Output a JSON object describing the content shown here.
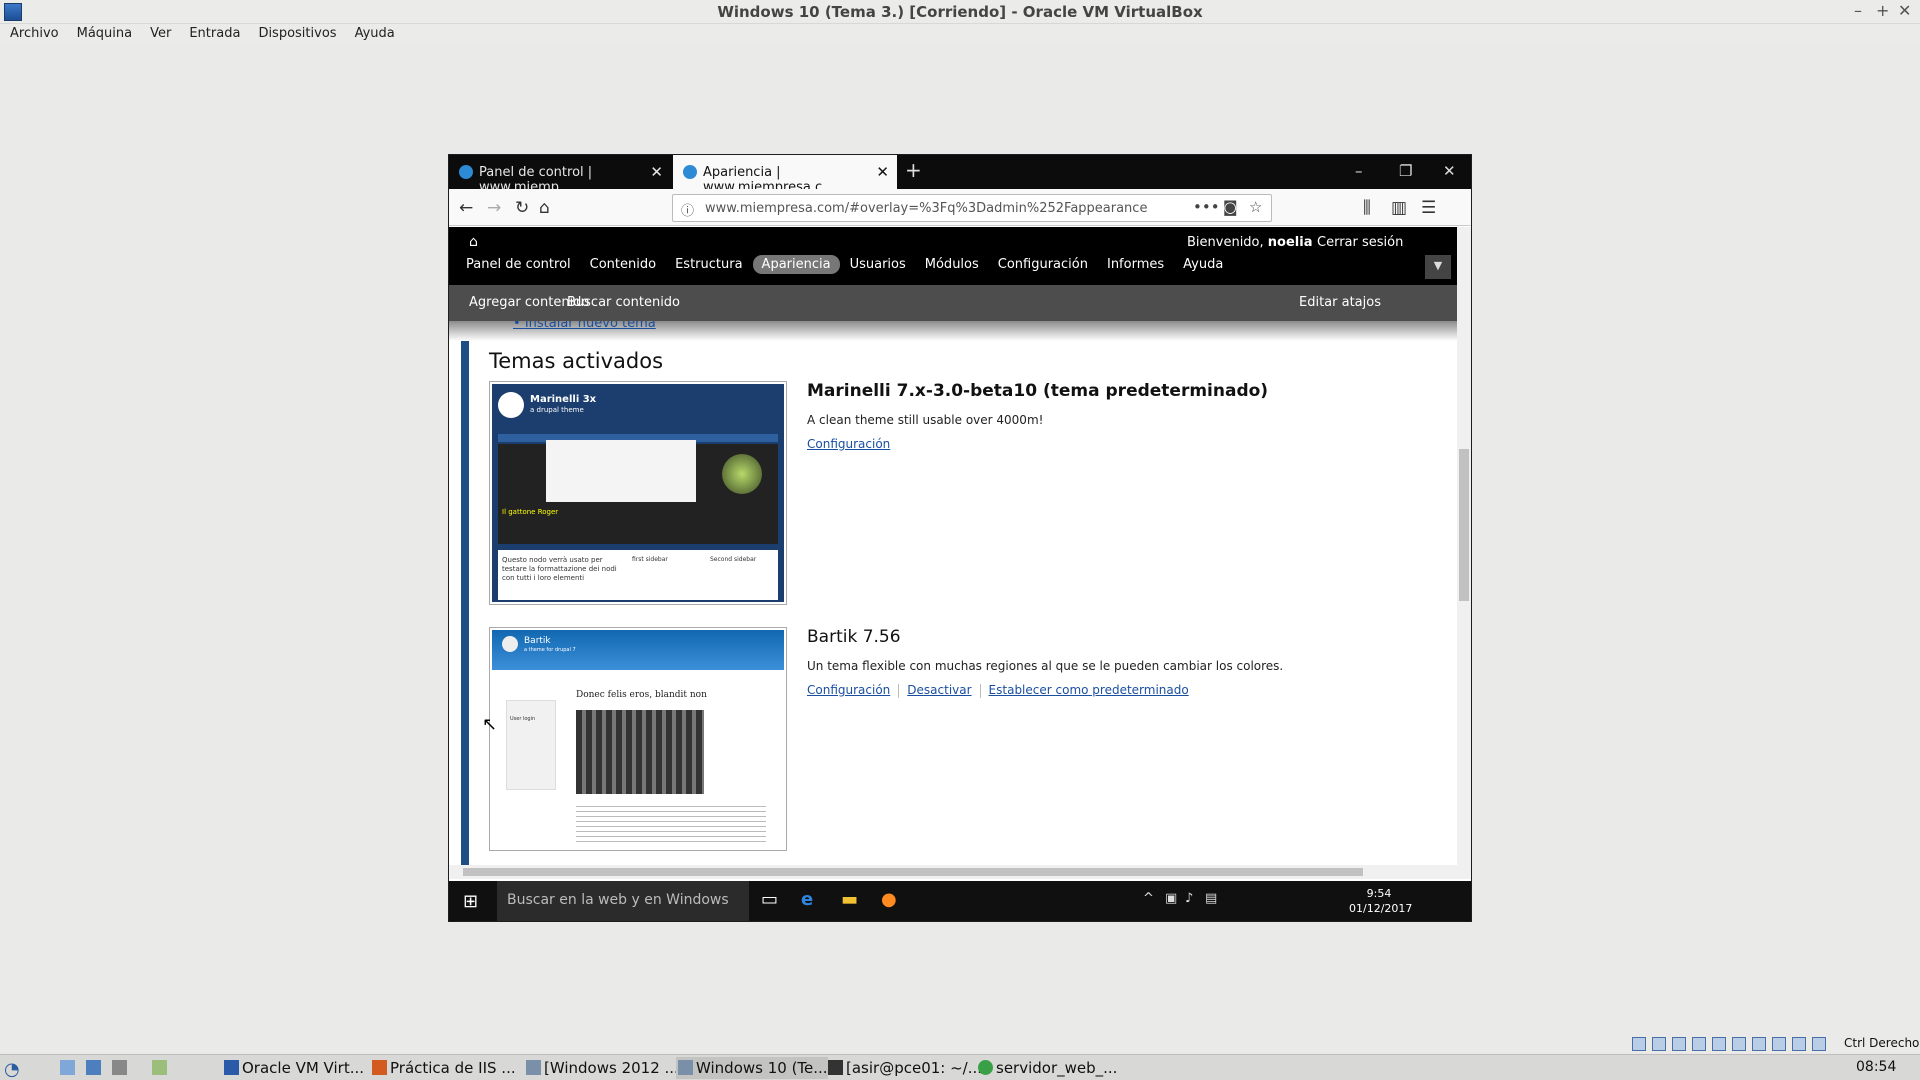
{
  "host": {
    "title": "Windows 10 (Tema 3.) [Corriendo] - Oracle VM VirtualBox",
    "menu": [
      "Archivo",
      "Máquina",
      "Ver",
      "Entrada",
      "Dispositivos",
      "Ayuda"
    ],
    "ctrl_key": "Ctrl Derecho",
    "taskbar": [
      {
        "label": "Oracle VM Virt...",
        "icon": "virtualbox-icon"
      },
      {
        "label": "Práctica de IIS ...",
        "icon": "document-icon"
      },
      {
        "label": "[Windows 2012 ...",
        "icon": "vm-window-icon"
      },
      {
        "label": "Windows 10 (Te...",
        "icon": "vm-window-icon"
      },
      {
        "label": "[asir@pce01: ~/...",
        "icon": "terminal-icon"
      },
      {
        "label": "servidor_web_...",
        "icon": "globe-icon"
      }
    ],
    "clock": "08:54"
  },
  "browser": {
    "tabs": [
      {
        "label": "Panel de control | www.miemp",
        "active": false
      },
      {
        "label": "Apariencia | www.miempresa.c",
        "active": true
      }
    ],
    "url": "www.miempresa.com/#overlay=%3Fq%3Dadmin%252Fappearance"
  },
  "drupal": {
    "welcome": "Bienvenido,",
    "user": "noelia",
    "logout": "Cerrar sesión",
    "menu": [
      "Panel de control",
      "Contenido",
      "Estructura",
      "Apariencia",
      "Usuarios",
      "Módulos",
      "Configuración",
      "Informes",
      "Ayuda"
    ],
    "active_menu": "Apariencia",
    "shortcuts": [
      "Agregar contenido",
      "Buscar contenido"
    ],
    "edit_shortcuts": "Editar atajos"
  },
  "page": {
    "install_link": "Instalar nuevo tema",
    "heading": "Temas activados",
    "themes": [
      {
        "title": "Marinelli 7.x-3.0-beta10 (tema predeterminado)",
        "description": "A clean theme still usable over 4000m!",
        "links": [
          "Configuración"
        ]
      },
      {
        "title": "Bartik 7.56",
        "description": "Un tema flexible con muchas regiones al que se le pueden cambiar los colores.",
        "links": [
          "Configuración",
          "Desactivar",
          "Establecer como predeterminado"
        ]
      }
    ],
    "marinelli_thumb": {
      "brand": "Marinelli 3x",
      "tagline": "a drupal theme",
      "feature_title": "Il gattone Roger",
      "body_text": "Questo nodo verrà usato per testare la formattazione dei nodi con tutti i loro elementi",
      "col1": "first sidebar",
      "col2": "Second sidebar"
    },
    "bartik_thumb": {
      "brand": "Bartik",
      "tagline": "a theme for drupal 7",
      "post_title": "Donec felis eros, blandit non",
      "login": "User login"
    }
  },
  "win10": {
    "search_placeholder": "Buscar en la web y en Windows",
    "time": "9:54",
    "date": "01/12/2017"
  }
}
